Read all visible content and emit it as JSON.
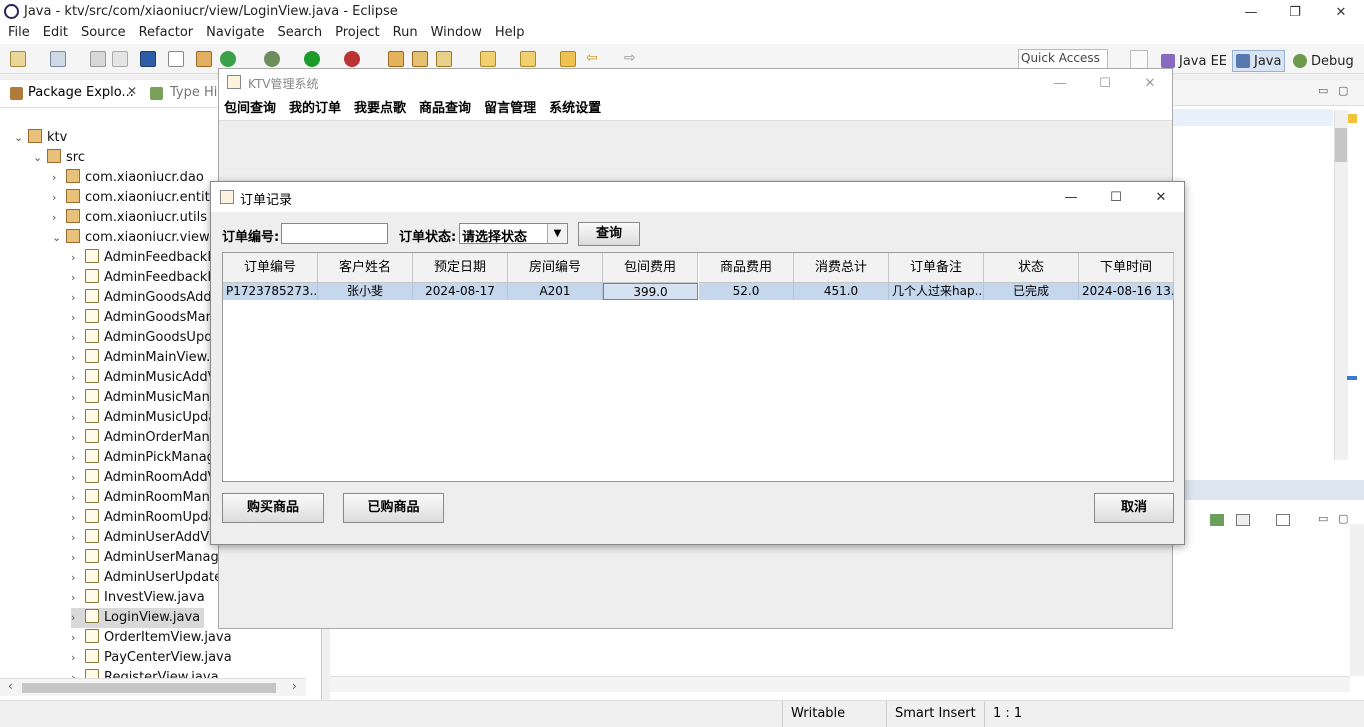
{
  "eclipse": {
    "title": "Java - ktv/src/com/xiaoniucr/view/LoginView.java - Eclipse",
    "menu": [
      "File",
      "Edit",
      "Source",
      "Refactor",
      "Navigate",
      "Search",
      "Project",
      "Run",
      "Window",
      "Help"
    ],
    "quick_access": "Quick Access",
    "perspectives": [
      "Java EE",
      "Java",
      "Debug"
    ]
  },
  "explorer": {
    "tabs": [
      "Package Explo...",
      "Type Hie"
    ],
    "tree": [
      {
        "label": "ktv",
        "depth": 0,
        "kind": "project"
      },
      {
        "label": "src",
        "depth": 1,
        "kind": "folder"
      },
      {
        "label": "com.xiaoniucr.dao",
        "depth": 2,
        "kind": "pkg"
      },
      {
        "label": "com.xiaoniucr.entity",
        "depth": 2,
        "kind": "pkg"
      },
      {
        "label": "com.xiaoniucr.utils",
        "depth": 2,
        "kind": "pkg"
      },
      {
        "label": "com.xiaoniucr.view",
        "depth": 2,
        "kind": "pkg"
      },
      {
        "label": "AdminFeedbackM",
        "depth": 3,
        "kind": "java"
      },
      {
        "label": "AdminFeedbackRe",
        "depth": 3,
        "kind": "java"
      },
      {
        "label": "AdminGoodsAddV",
        "depth": 3,
        "kind": "java"
      },
      {
        "label": "AdminGoodsMana",
        "depth": 3,
        "kind": "java"
      },
      {
        "label": "AdminGoodsUpda",
        "depth": 3,
        "kind": "java"
      },
      {
        "label": "AdminMainView.ja",
        "depth": 3,
        "kind": "java"
      },
      {
        "label": "AdminMusicAddVi",
        "depth": 3,
        "kind": "java"
      },
      {
        "label": "AdminMusicMana",
        "depth": 3,
        "kind": "java"
      },
      {
        "label": "AdminMusicUpdat",
        "depth": 3,
        "kind": "java"
      },
      {
        "label": "AdminOrderMana",
        "depth": 3,
        "kind": "java"
      },
      {
        "label": "AdminPickManage",
        "depth": 3,
        "kind": "java"
      },
      {
        "label": "AdminRoomAddVi",
        "depth": 3,
        "kind": "java"
      },
      {
        "label": "AdminRoomMana",
        "depth": 3,
        "kind": "java"
      },
      {
        "label": "AdminRoomUpda",
        "depth": 3,
        "kind": "java"
      },
      {
        "label": "AdminUserAddVie",
        "depth": 3,
        "kind": "java"
      },
      {
        "label": "AdminUserManage",
        "depth": 3,
        "kind": "java"
      },
      {
        "label": "AdminUserUpdateV",
        "depth": 3,
        "kind": "java"
      },
      {
        "label": "InvestView.java",
        "depth": 3,
        "kind": "java"
      },
      {
        "label": "LoginView.java",
        "depth": 3,
        "kind": "java",
        "selected": true
      },
      {
        "label": "OrderItemView.java",
        "depth": 3,
        "kind": "java"
      },
      {
        "label": "PayCenterView.java",
        "depth": 3,
        "kind": "java"
      },
      {
        "label": "RegisterView.java",
        "depth": 3,
        "kind": "java"
      }
    ]
  },
  "status": {
    "writable": "Writable",
    "insert": "Smart Insert",
    "position": "1 : 1"
  },
  "ktv_window": {
    "title": "KTV管理系统",
    "menu": [
      "包间查询",
      "我的订单",
      "我要点歌",
      "商品查询",
      "留言管理",
      "系统设置"
    ]
  },
  "order_dialog": {
    "title": "订单记录",
    "order_no_label": "订单编号:",
    "order_no_value": "",
    "status_label": "订单状态:",
    "status_selected": "请选择状态",
    "query_button": "查询",
    "columns": [
      "订单编号",
      "客户姓名",
      "预定日期",
      "房间编号",
      "包间费用",
      "商品费用",
      "消费总计",
      "订单备注",
      "状态",
      "下单时间"
    ],
    "rows": [
      [
        "P1723785273...",
        "张小斐",
        "2024-08-17",
        "A201",
        "399.0",
        "52.0",
        "451.0",
        "几个人过来hap...",
        "已完成",
        "2024-08-16 13..."
      ]
    ],
    "buy_button": "购买商品",
    "bought_button": "已购商品",
    "cancel_button": "取消"
  }
}
